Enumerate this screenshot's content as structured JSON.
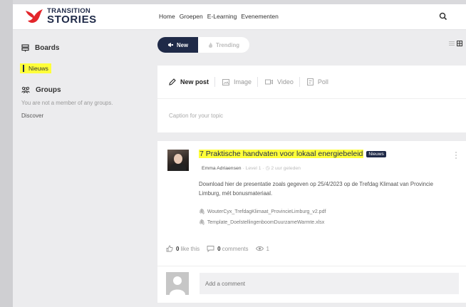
{
  "brand": {
    "line1": "TRANSITION",
    "line2": "STORIES",
    "accent": "#e3262b",
    "navy": "#1f2a48"
  },
  "nav": [
    "Home",
    "Groepen",
    "E-Learning",
    "Evenementen"
  ],
  "sidebar": {
    "boards_label": "Boards",
    "active_board": "Nieuws",
    "groups_label": "Groups",
    "groups_note": "You are not a member of any groups.",
    "discover_label": "Discover"
  },
  "feed_tabs": {
    "new": "New",
    "trending": "Trending"
  },
  "composer": {
    "options": [
      "New post",
      "Image",
      "Video",
      "Poll"
    ],
    "caption_placeholder": "Caption for your topic"
  },
  "post": {
    "title": "7 Praktische handvaten voor lokaal energiebeleid",
    "badge": "Nieuws",
    "author": "Emma Adriaensen",
    "level": "Level 1",
    "time": "2 uur geleden",
    "body": "Download hier de presentatie zoals gegeven op 25/4/2023 op de Trefdag Klimaat van Provincie Limburg, mét bonusmateriaal.",
    "attachments": [
      "WouterCyx_TrefdagKlimaat_ProvincieLimburg_v2.pdf",
      "Template_DoelstellingenboomDuurzameWarmte.xlsx"
    ],
    "likes": "0",
    "like_label": "like this",
    "comments": "0",
    "comments_label": "comments",
    "views": "1"
  },
  "comment_placeholder": "Add a comment",
  "highlight_color": "#ffff3a"
}
